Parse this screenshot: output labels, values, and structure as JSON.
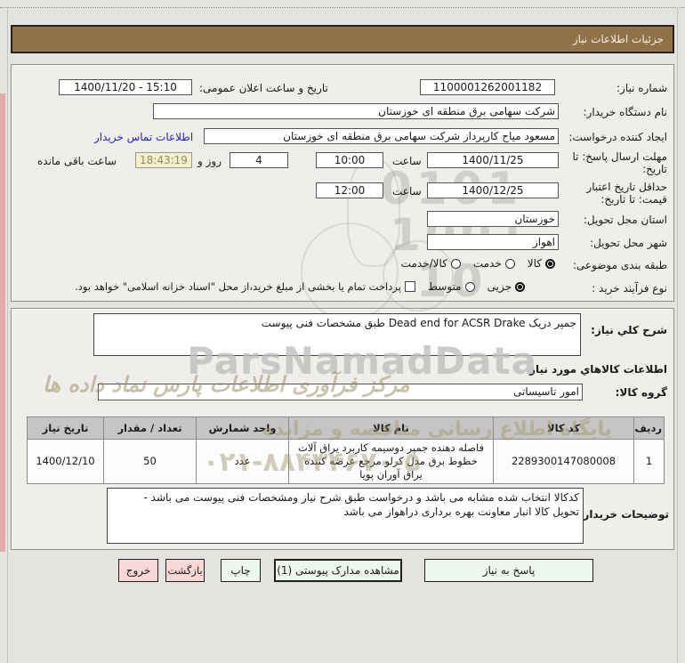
{
  "header": {
    "title": "جزئیات اطلاعات نیاز"
  },
  "form": {
    "need_number_label": "شماره نیاز:",
    "need_number": "1100001262001182",
    "announce_label": "تاریخ و ساعت اعلان عمومی:",
    "announce_value": "1400/11/20 - 15:10",
    "buyer_org_label": "نام دستگاه خریدار:",
    "buyer_org": "شرکت سهامی برق منطقه ای خوزستان",
    "creator_label": "ایجاد کننده درخواست:",
    "creator": "مسعود میاح کارپرداز شرکت سهامی برق منطقه ای خوزستان",
    "contact_link": "اطلاعات تماس خریدار",
    "deadline_label": "مهلت ارسال پاسخ: تا\nتاریخ:",
    "deadline_date": "1400/11/25",
    "hour_label": "ساعت",
    "deadline_time": "10:00",
    "days_value": "4",
    "days_label": "روز و",
    "remaining_time": "18:43:19",
    "remaining_label": "ساعت باقی مانده",
    "validity_label": "حداقل تاریخ اعتبار\nقیمت: تا تاریخ:",
    "validity_date": "1400/12/25",
    "validity_time": "12:00",
    "province_label": "استان محل تحویل:",
    "province": "خوزستان",
    "city_label": "شهر محل تحویل:",
    "city": "اهواز",
    "classification_label": "طبقه بندی موضوعی:",
    "class_options": [
      "کالا",
      "خدمت",
      "کالا/خدمت"
    ],
    "process_label": "نوع فرآیند خرید :",
    "process_options": [
      "جزیی",
      "متوسط"
    ],
    "treasury_checkbox_label": "پرداخت تمام یا بخشی از مبلغ خرید،از محل \"اسناد خزانه اسلامی\" خواهد بود."
  },
  "details": {
    "desc_label": "شرح کلي نیاز:",
    "desc_value": "جمپر دریک  Dead end for ACSR  Drake  طبق مشخصات فنی پیوست",
    "goods_info_title": "اطلاعات کالاهاي مورد نیاز",
    "group_label": "گروه کالا:",
    "group_value": "امور تاسیساتی",
    "table": {
      "headers": [
        "ردیف",
        "کد کالا",
        "نام کالا",
        "واحد شمارش",
        "تعداد / مقدار",
        "تاریخ نیاز"
      ],
      "rows": [
        {
          "row": "1",
          "code": "2289300147080008",
          "name": "فاصله دهنده جمپر دوسیمه کاربرد یراق آلات خطوط برق مدل کرلو مرجع عرضه کننده یراق آوران پویا",
          "unit": "عدد",
          "qty": "50",
          "date": "1400/12/10"
        }
      ]
    },
    "buyer_notes_label": "توضیحات خریدار:",
    "buyer_notes": "کدکالا انتخاب شده مشابه می باشد و درخواست طبق شرح نیاز ومشخصات فنی پیوست می باشد -\nتحویل کالا انبار معاونت بهره برداری دراهواز می باشد"
  },
  "buttons": {
    "respond": "پاسخ به نیاز",
    "view_docs": "مشاهده مدارک پیوستی (1)",
    "print": "چاپ",
    "back": "بازگشت",
    "exit": "خروج"
  },
  "watermark": {
    "digits1": "0101",
    "digits2": "1001",
    "digits3": "10",
    "brand": "ParsNamadData",
    "calligraphy": "مرکز فرآوری اطلاعات پارس نماد داده ها",
    "site_text": "پایگاه اطلاع رسانی مناقصه و مزایده",
    "phone": "۰۲۱-۸۸۴۳۴۶۷۰-۵"
  },
  "colors": {
    "accent_brown": "#8F7247",
    "timer_bg": "#F3EFC9",
    "button_green": "#EDF7ED",
    "button_pink": "#F8D8D6",
    "link_blue": "#2323CC"
  }
}
